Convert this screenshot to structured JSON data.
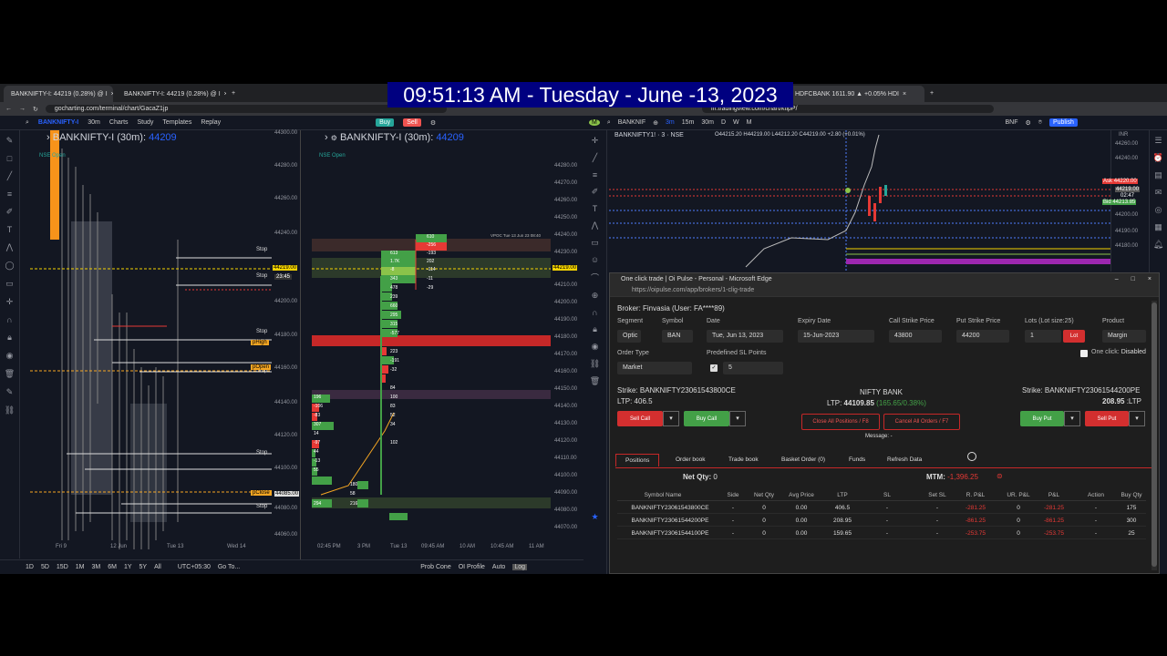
{
  "overlay": {
    "clock": "09:51:13 AM - Tuesday - June -13, 2023"
  },
  "left_browser": {
    "tabs": [
      "BANKNIFTY-I: 44219 (0.28%) @ I",
      "BANKNIFTY-I: 44219 (0.28%) @ I"
    ],
    "url": "gocharting.com/terminal/chart/GacaZ1jp",
    "toolbar": {
      "symbol": "BANKNIFTY-I",
      "interval": "30m",
      "charts": "Charts",
      "study": "Study",
      "templates": "Templates",
      "replay": "Replay",
      "buy": "Buy",
      "sell": "Sell"
    },
    "chart1": {
      "title": "BANKNIFTY-I (30m):",
      "price": "44209",
      "market": "NSE Open",
      "y_ticks": [
        "44300.00",
        "44280.00",
        "44260.00",
        "44240.00",
        "44219.00",
        "44200.00",
        "44180.00",
        "44160.00",
        "44140.00",
        "44120.00",
        "44100.00",
        "44080.00",
        "44060.00"
      ],
      "x_ticks": [
        "Fri 9",
        "12 Jun",
        "Tue 13",
        "Wed 14"
      ],
      "stops": [
        "Stop",
        "Stop",
        "Stop",
        "Stop",
        "Stop",
        "Stop"
      ],
      "price_tags": [
        "44219.00",
        "23:45",
        "pHigh",
        "pOpen",
        "pClose",
        "44085.00"
      ]
    },
    "chart2": {
      "title": "BANKNIFTY-I (30m):",
      "price": "44209",
      "market": "NSE Open",
      "y_ticks": [
        "44280.00",
        "44270.00",
        "44260.00",
        "44250.00",
        "44240.00",
        "44230.00",
        "44219.00",
        "44210.00",
        "44200.00",
        "44190.00",
        "44180.00",
        "44170.00",
        "44160.00",
        "44150.00",
        "44140.00",
        "44130.00",
        "44120.00",
        "44110.00",
        "44100.00",
        "44090.00",
        "44080.00",
        "44070.00"
      ],
      "x_ticks": [
        "02:45 PM",
        "3 PM",
        "Tue 13",
        "09:45 AM",
        "10 AM",
        "10:45 AM",
        "11 AM"
      ],
      "vpoc": "VPOC Tue 13 Jun 23 08:40",
      "ladder": [
        "610",
        "-256",
        "613",
        "-193",
        "1.7K",
        "202",
        "-8",
        "-114",
        "343",
        "-11",
        "478",
        "-29",
        "239",
        "660",
        "295",
        "315",
        "-577",
        "223",
        "-191",
        "-32",
        "84",
        "100",
        "83",
        "52",
        "34",
        "102",
        "196",
        "-106",
        "-83",
        "307",
        "14",
        "-97",
        "44",
        "-13",
        "55",
        "180",
        "58",
        "294",
        "216"
      ]
    },
    "bottom": {
      "ranges": [
        "1D",
        "5D",
        "15D",
        "1M",
        "3M",
        "6M",
        "1Y",
        "5Y",
        "All"
      ],
      "tz": "UTC+05:30",
      "goto": "Go To...",
      "prob_cone": "Prob Cone",
      "oi_profile": "OI Profile",
      "auto": "Auto",
      "log": "Log"
    }
  },
  "right_browser": {
    "tab": "HDFCBANK 1611.90 ▲ +0.05% HDI",
    "url": "in.tradingview.com/chart/ktlpP/",
    "toolbar": {
      "symbol": "BANKNIF",
      "tf": [
        "3m",
        "15m",
        "30m",
        "D",
        "W",
        "M"
      ],
      "right": "BNF",
      "publish": "Publish"
    },
    "chart": {
      "title": "BANKNIFTY1! · 3 · NSE",
      "ohlc": "O44215.20 H44219.00 L44212.20 C44219.00 +2.80 (+0.01%)",
      "y_ticks": [
        "44260.00",
        "44240.00",
        "44220.00",
        "44200.00",
        "44190.00",
        "44180.00"
      ],
      "ask": "Ask",
      "ask_price": "44220.00",
      "last": "44219.00",
      "time": "02:47",
      "bid": "Bid",
      "bid_price": "44213.85",
      "currency": "INR"
    }
  },
  "popup": {
    "title": "One click trade | Oi Pulse - Personal - Microsoft Edge",
    "url": "https://oipulse.com/app/brokers/1-clig-trade",
    "broker": "Broker: Finvasia (User: FA****89)",
    "labels": {
      "segment": "Segment",
      "symbol": "Symbol",
      "date": "Date",
      "expiry": "Expiry Date",
      "call_strike": "Call Strike Price",
      "put_strike": "Put Strike Price",
      "lots": "Lots (Lot size:25)",
      "product": "Product",
      "order_type": "Order Type",
      "sl_points": "Predefined SL Points",
      "one_click": "One click:"
    },
    "values": {
      "segment": "Optic",
      "symbol": "BAN",
      "date": "Tue, Jun 13, 2023",
      "expiry": "15-Jun-2023",
      "call_strike": "43800",
      "put_strike": "44200",
      "lots": "1",
      "lot_btn": "Lot",
      "product": "Margin",
      "order_type": "Market",
      "sl_points": "5",
      "one_click": "Disabled"
    },
    "call": {
      "strike": "Strike: BANKNIFTY23061543800CE",
      "ltp_label": "LTP:",
      "ltp": "406.5",
      "sell": "Sell Call",
      "buy": "Buy Call"
    },
    "index": {
      "name": "NIFTY BANK",
      "ltp_label": "LTP:",
      "ltp": "44109.85",
      "chg": "(165.65/0.38%)"
    },
    "put": {
      "strike": "Strike: BANKNIFTY23061544200PE",
      "ltp": "208.95",
      "ltp_label": ":LTP",
      "buy": "Buy Put",
      "sell": "Sell Put"
    },
    "actions": {
      "close_all": "Close All Positions / F8",
      "cancel_all": "Cancel All Orders / F7",
      "message": "Message: -"
    },
    "tabs": [
      "Positions",
      "Order book",
      "Trade book",
      "Basket Order (0)",
      "Funds",
      "Refresh Data"
    ],
    "net_qty_label": "Net Qty:",
    "net_qty": "0",
    "mtm_label": "MTM:",
    "mtm": "-1,396.25",
    "columns": [
      "Symbol Name",
      "Side",
      "Net Qty",
      "Avg Price",
      "LTP",
      "SL",
      "Set SL",
      "R. P&L",
      "UR. P&L",
      "P&L",
      "Action",
      "Buy Qty"
    ],
    "rows": [
      [
        "BANKNIFTY23061543800CE",
        "-",
        "0",
        "0.00",
        "406.5",
        "-",
        "-",
        "-281.25",
        "0",
        "-281.25",
        "-",
        "175"
      ],
      [
        "BANKNIFTY23061544200PE",
        "-",
        "0",
        "0.00",
        "208.95",
        "-",
        "-",
        "-861.25",
        "0",
        "-861.25",
        "-",
        "300"
      ],
      [
        "BANKNIFTY23061544100PE",
        "-",
        "0",
        "0.00",
        "159.65",
        "-",
        "-",
        "-253.75",
        "0",
        "-253.75",
        "-",
        "25"
      ]
    ]
  }
}
